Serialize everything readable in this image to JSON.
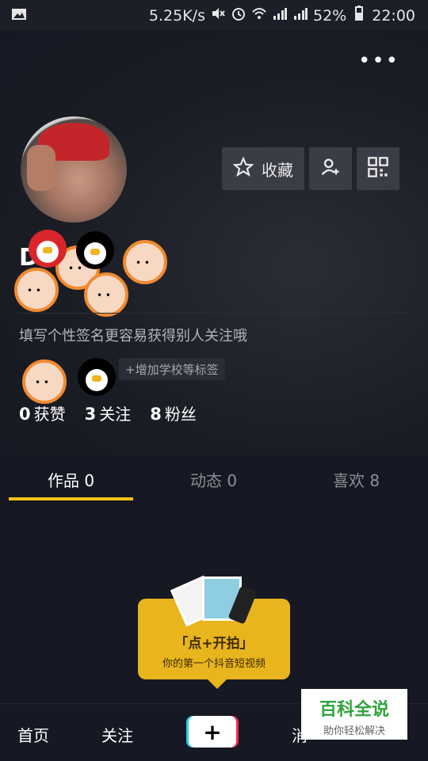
{
  "statusbar": {
    "network_speed": "5.25K/s",
    "battery": "52%",
    "time": "22:00"
  },
  "profile": {
    "nickname": "D",
    "signature": "填写个性签名更容易获得别人关注哦",
    "buttons": {
      "collect_label": "收藏"
    },
    "tags": {
      "school_label": "+增加学校等标签"
    },
    "stats": {
      "likes_count": "0",
      "likes_label": "获赞",
      "following_count": "3",
      "following_label": "关注",
      "fans_count": "8",
      "fans_label": "粉丝"
    }
  },
  "tabs": [
    {
      "label": "作品 0"
    },
    {
      "label": "动态 0"
    },
    {
      "label": "喜欢 8"
    }
  ],
  "empty_state": {
    "title": "「点+开拍」",
    "subtitle": "你的第一个抖音短视频"
  },
  "bottom_nav": {
    "home": "首页",
    "follow": "关注",
    "message": "消"
  },
  "watermark": {
    "title": "百科全说",
    "subtitle": "助你轻松解决"
  },
  "colors": {
    "accent": "#f8c21b",
    "background": "#161823",
    "button_bg": "#3a3c46"
  }
}
